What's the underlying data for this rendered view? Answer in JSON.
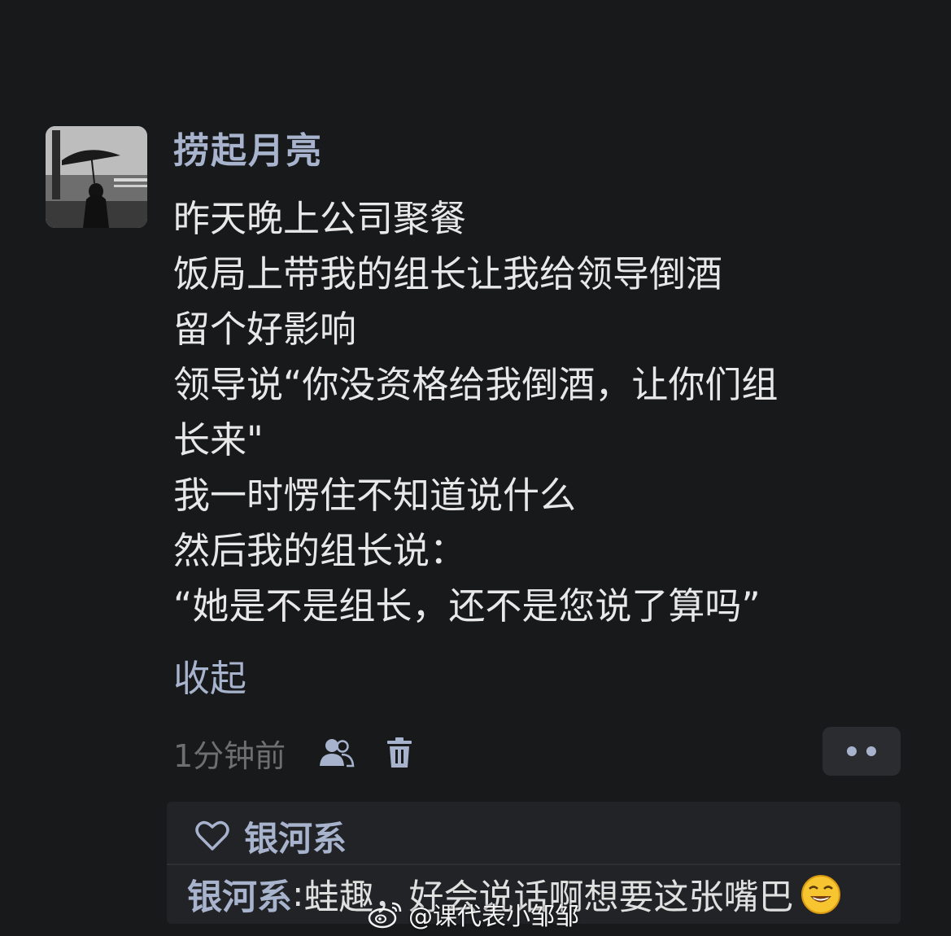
{
  "post": {
    "author": "捞起月亮",
    "lines": [
      "昨天晚上公司聚餐",
      "饭局上带我的组长让我给领导倒酒",
      "留个好影响",
      "领导说“你没资格给我倒酒，让你们组",
      "长来\"",
      "我一时愣住不知道说什么",
      "然后我的组长说：",
      "“她是不是组长，还不是您说了算吗”"
    ],
    "collapse_label": "收起",
    "time": "1分钟前"
  },
  "icons": {
    "visibility": "people-icon",
    "delete": "trash-icon",
    "more": "more-dots-icon",
    "like": "heart-icon",
    "emoji": "grinning-emoji-icon",
    "watermark_logo": "weibo-logo-icon"
  },
  "likes": {
    "names": "银河系"
  },
  "comment": {
    "user": "银河系",
    "separator": ": ",
    "text": "蛙趣，好会说话啊想要这张嘴巴"
  },
  "watermark": {
    "text": "@课代表小邹邹"
  },
  "colors": {
    "background": "#18191b",
    "accent": "#a8b4cd",
    "text": "#e8e8e8",
    "muted": "#6f6f6f",
    "panel": "#222326"
  }
}
